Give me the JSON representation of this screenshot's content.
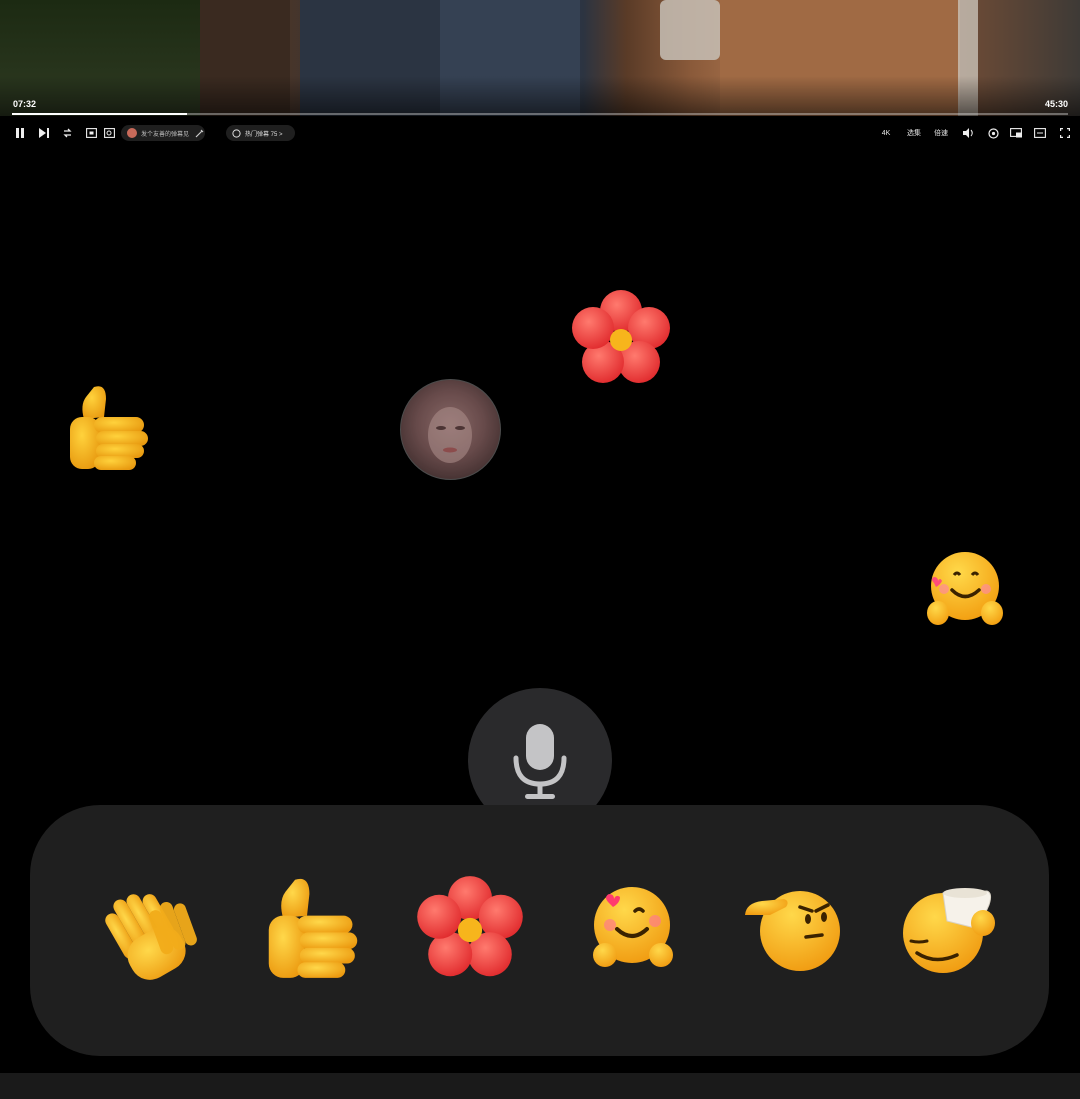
{
  "player": {
    "current_time": "07:32",
    "total_time": "45:30",
    "progress": 0.166,
    "danmaku_placeholder": "发个友善的弹幕见证当下",
    "comment_label": "热门弹幕 75 >",
    "quality_label": "4K",
    "episodes_label": "选集",
    "speed_label": "倍速"
  },
  "floating_reactions": [
    "thumbs-up",
    "flower",
    "smiling-hug",
    "avatar"
  ],
  "tray": {
    "emojis": [
      "clapping-hands",
      "thumbs-up",
      "flower",
      "blushing-hug",
      "saluting-face",
      "drinking-face"
    ]
  },
  "colors": {
    "background": "#000000",
    "tray": "#1f1f1f",
    "mic_circle": "#2a2a2c",
    "emoji_yellow": "#f7b51c",
    "flower_red": "#ef4040"
  }
}
